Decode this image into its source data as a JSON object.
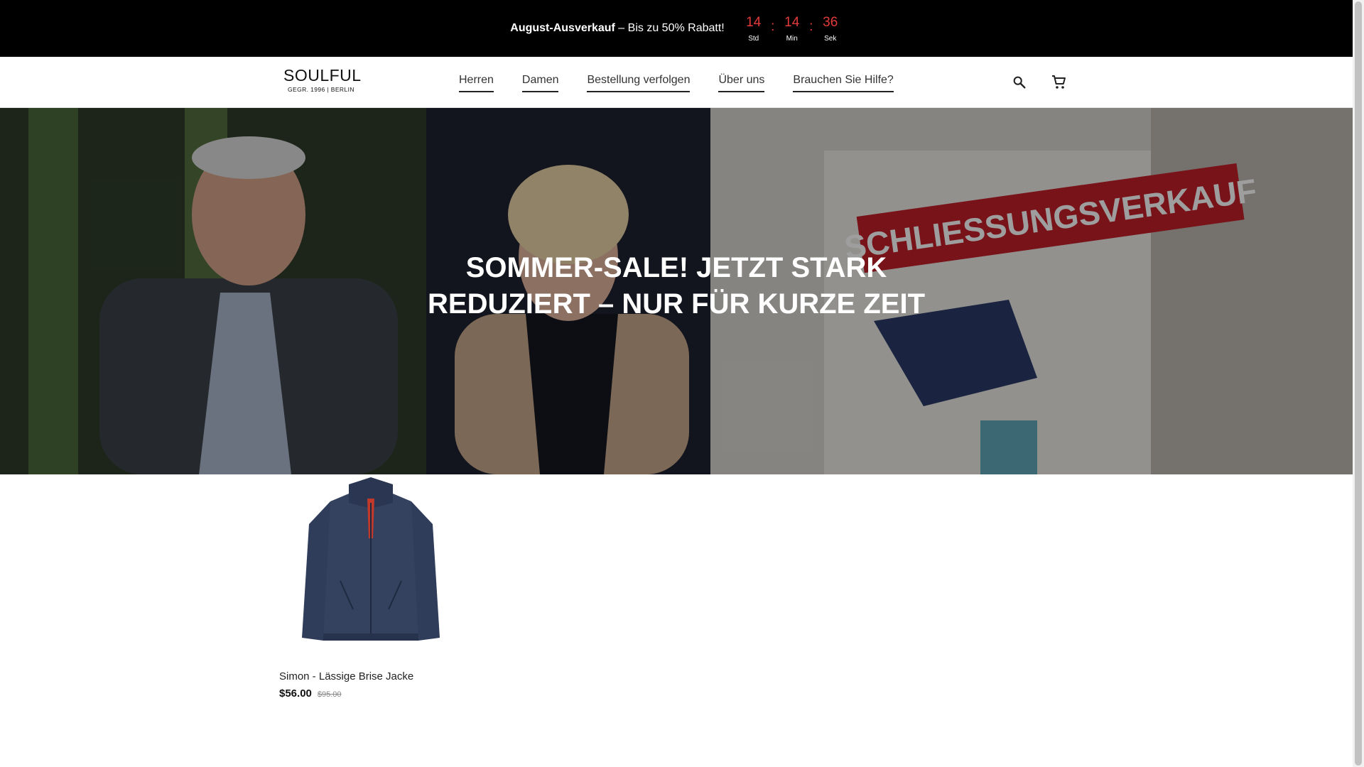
{
  "announcement": {
    "bold": "August-Ausverkauf",
    "rest": " – Bis zu 50% Rabatt!",
    "countdown": {
      "hours": "14",
      "hours_label": "Std",
      "minutes": "14",
      "minutes_label": "Min",
      "seconds": "36",
      "seconds_label": "Sek",
      "separator": ":"
    },
    "accent_color": "#e23a3a"
  },
  "header": {
    "logo_main": "SOULFUL",
    "logo_sub": "GEGR. 1996 | BERLIN",
    "nav": [
      {
        "label": "Herren"
      },
      {
        "label": "Damen"
      },
      {
        "label": "Bestellung verfolgen"
      },
      {
        "label": "Über uns"
      },
      {
        "label": "Brauchen Sie Hilfe?"
      }
    ],
    "icons": {
      "search": "search-icon",
      "cart": "cart-icon"
    }
  },
  "hero": {
    "title": "SOMMER-SALE! JETZT STARK REDUZIERT – NUR FÜR KURZE ZEIT",
    "sign_text": "SCHLIESSUNGSVERKAUF"
  },
  "products": [
    {
      "name": "Simon - Lässige Brise Jacke",
      "price": "$56.00",
      "compare_price": "$95.00"
    }
  ]
}
